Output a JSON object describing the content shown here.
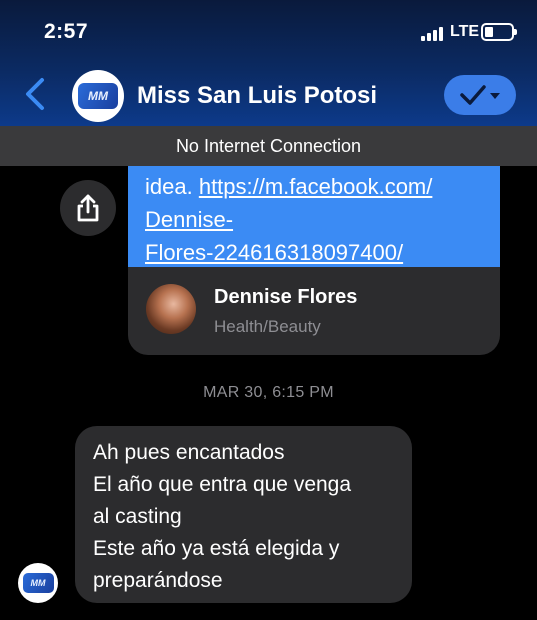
{
  "status_bar": {
    "time": "2:57",
    "network": "LTE",
    "signal_icon": "signal-bars-icon",
    "battery_icon": "battery-low-icon"
  },
  "header": {
    "back_icon": "chevron-left-icon",
    "avatar_text": "MM",
    "title": "Miss San Luis Potosi",
    "verify_icon": "checkmark-dropdown-icon",
    "accent_color": "#3b7de8"
  },
  "banner": {
    "text": "No Internet Connection"
  },
  "link_message": {
    "share_icon": "share-icon",
    "prefix": "idea. ",
    "url": "https://m.facebook.com/Dennise-Flores-224616318097400/",
    "url_lines": [
      "https://m.facebook.com/",
      "Dennise-",
      "Flores-224616318097400/"
    ],
    "preview": {
      "name": "Dennise Flores",
      "category": "Health/Beauty"
    },
    "bubble_color": "#3b8bf4"
  },
  "timestamp": "MAR 30, 6:15 PM",
  "message": {
    "avatar_text": "MM",
    "lines": [
      "Ah pues encantados",
      "El año que entra que venga",
      "al casting",
      "Este año ya está elegida y",
      "preparándose"
    ]
  }
}
